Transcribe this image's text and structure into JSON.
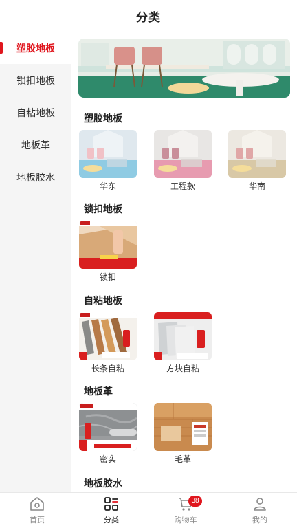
{
  "header": {
    "title": "分类"
  },
  "sidebar": {
    "items": [
      {
        "label": "塑胶地板",
        "active": true
      },
      {
        "label": "锁扣地板",
        "active": false
      },
      {
        "label": "自粘地板",
        "active": false
      },
      {
        "label": "地板革",
        "active": false
      },
      {
        "label": "地板胶水",
        "active": false
      }
    ]
  },
  "sections": [
    {
      "title": "塑胶地板",
      "items": [
        {
          "label": "华东"
        },
        {
          "label": "工程款"
        },
        {
          "label": "华南"
        }
      ]
    },
    {
      "title": "锁扣地板",
      "items": [
        {
          "label": "锁扣"
        }
      ]
    },
    {
      "title": "自粘地板",
      "items": [
        {
          "label": "长条自粘"
        },
        {
          "label": "方块自粘"
        }
      ]
    },
    {
      "title": "地板革",
      "items": [
        {
          "label": "密实"
        },
        {
          "label": "毛革"
        }
      ]
    },
    {
      "title": "地板胶水",
      "items": []
    }
  ],
  "tabbar": {
    "items": [
      {
        "label": "首页",
        "icon": "home-icon",
        "active": false
      },
      {
        "label": "分类",
        "icon": "category-icon",
        "active": true
      },
      {
        "label": "购物车",
        "icon": "cart-icon",
        "active": false,
        "badge": "38"
      },
      {
        "label": "我的",
        "icon": "profile-icon",
        "active": false
      }
    ]
  },
  "colors": {
    "accent": "#e0161e",
    "sidebar_bg": "#f5f5f5"
  }
}
